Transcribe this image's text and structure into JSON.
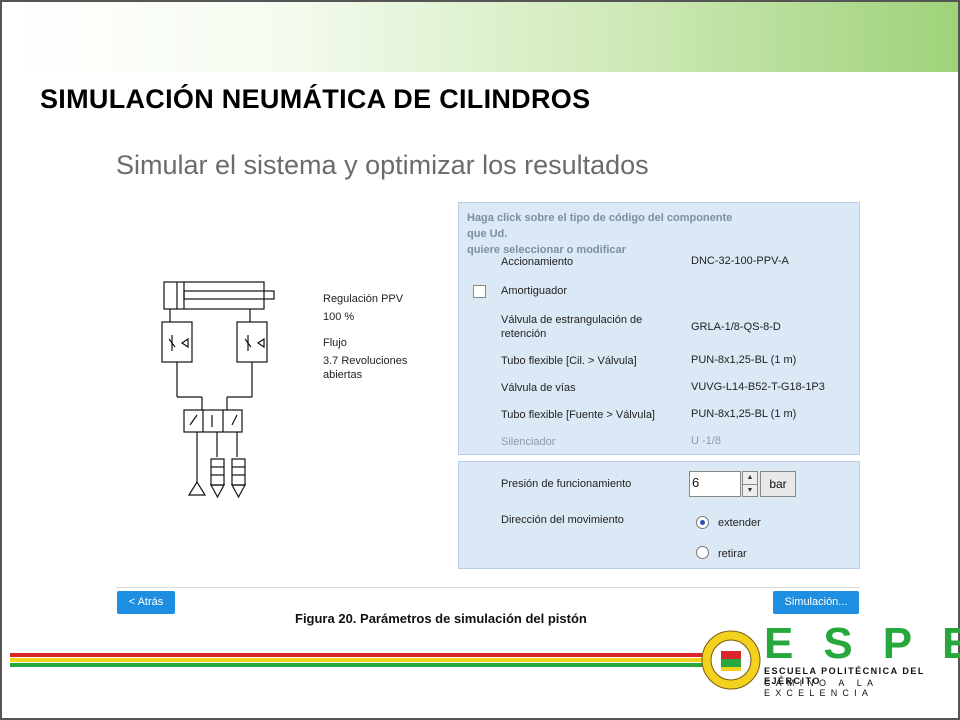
{
  "slide": {
    "title": "SIMULACIÓN NEUMÁTICA DE CILINDROS",
    "caption": "Figura 20.  Parámetros de simulación del pistón"
  },
  "app": {
    "heading": "Simular el sistema y optimizar los resultados",
    "regulation": {
      "label": "Regulación PPV",
      "value": "100  %",
      "flow_label": "Flujo",
      "flow_value_line1": "3.7 Revoluciones",
      "flow_value_line2": "abiertas"
    },
    "components": {
      "header_line1": "Haga click sobre el tipo de código del componente que Ud.",
      "header_line2": "quiere seleccionar o modificar",
      "rows": [
        {
          "label": "Accionamiento",
          "value": "DNC-32-100-PPV-A"
        },
        {
          "label": "Amortiguador",
          "value": ""
        },
        {
          "label_line1": "Válvula de estrangulación de",
          "label_line2": "retención",
          "value": "GRLA-1/8-QS-8-D"
        },
        {
          "label": "Tubo flexible [Cil. > Válvula]",
          "value": "PUN-8x1,25-BL   (1 m)"
        },
        {
          "label": "Válvula de vías",
          "value": "VUVG-L14-B52-T-G18-1P3"
        },
        {
          "label": "Tubo flexible [Fuente > Válvula]",
          "value": "PUN-8x1,25-BL   (1 m)"
        },
        {
          "label": "Silenciador",
          "value": "U -1/8"
        }
      ]
    },
    "params": {
      "pressure_label": "Presión de funcionamiento",
      "pressure_value": "6",
      "pressure_unit": "bar",
      "direction_label": "Dirección del movimiento",
      "options": [
        "extender",
        "retirar"
      ],
      "selected": "extender"
    },
    "buttons": {
      "back": "< Atrás",
      "simulate": "Simulación..."
    }
  },
  "branding": {
    "letters": "ESPE",
    "line1": "ESCUELA POLITÉCNICA DEL EJÉRCITO",
    "line2": "CAMINO A LA EXCELENCIA",
    "green": "#27a83d",
    "red": "#d9262b",
    "yellow": "#f2d21c"
  },
  "colors": {
    "panel": "#dbe8f5",
    "button": "#1e8fe0"
  }
}
